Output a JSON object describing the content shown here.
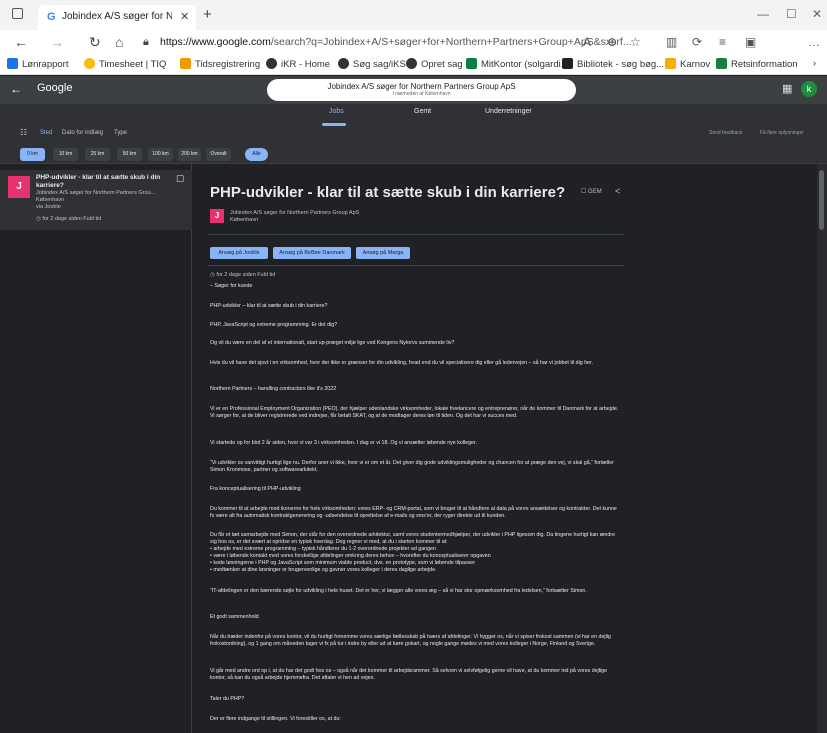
{
  "browser": {
    "tab_title": "Jobindex A/S søger for Northern",
    "url_host": "https://www.google.com",
    "url_rest": "/search?q=Jobindex+A/S+søger+for+Northern+Partners+Group+ApS&sxsrf...",
    "bookmarks": [
      "Lønrapport",
      "Timesheet | TIQ",
      "Tidsregistrering",
      "iKR - Home",
      "Søg sag/iKS",
      "Opret sag",
      "MitKontor (solgardi...",
      "Bibliotek - søg bøg...",
      "Karnov",
      "Retsinformation"
    ]
  },
  "google": {
    "logo": "Google",
    "search_query": "Jobindex A/S søger for Northern Partners Group ApS",
    "search_sub": "I nærheden af København",
    "avatar": "k",
    "tabs": [
      "Jobs",
      "Gemt",
      "Underretninger"
    ]
  },
  "filters": {
    "items": [
      "Sted",
      "Dato for indlæg",
      "Type"
    ],
    "chips": [
      "0 km",
      "10 km",
      "25 km",
      "50 km",
      "100 km",
      "200 km",
      "Overalt"
    ],
    "pill": "Alle",
    "right_links": [
      "Send feedback",
      "Få flere oplysninger"
    ]
  },
  "listing": {
    "logo": "J",
    "title": "PHP-udvikler - klar til at sætte skub i din karriere?",
    "company": "Jobindex A/S søger for Northern Partners Grou...",
    "location": "København",
    "via": "via Jooble",
    "meta": "for 2 dage siden   Fuld tid"
  },
  "detail": {
    "title": "PHP-udvikler - klar til at sætte skub i din karriere?",
    "gem": "GEM",
    "logo": "J",
    "company": "Jobindex A/S søger for Northern Partners Group ApS",
    "location": "København",
    "apply_buttons": [
      "Ansøg på Jooble",
      "Ansøg på BeBee Danmark",
      "Ansøg på Marga"
    ],
    "meta": "for 2 dage siden   Fuld tid",
    "paragraphs": [
      "– Søger for kunde",
      "PHP-udvikler – klar til at sætte skub i din karriere?",
      "PHP, JavaScript og extreme programming. Er det dig?",
      "Og vil du være en del af et internationalt, start up-præget miljø lige ved Kongens Nytorvs summende liv?",
      "Hvis du vil have det sjovt i en virksomhed, hvor der ikke er grænser for din udvikling, hvad end du vil specialisere dig eller gå ledervejen – så har vi jobbet til dig her.",
      "Northern Partners – handling contractors like it's 2022",
      "Vi er en Professional Employment Organization (PEO), der hjælper udenlandske virksomheder, lokale freelancere og entreprenører, når de kommer til Danmark for at arbejde. Vi sørger for, at de bliver registrerede ved indrejse, får betalt SKAT, og at de modtager deres løn til tiden. Og det har vi succes med.",
      "Vi startede op for blot 2 år siden, hvor vi var 3 i virksomheden. I dag er vi 18. Og vi ansætter løbende nye kolleger.",
      "“Vi udvikler os vanvittigt hurtigt lige nu. Derfor aner vi ikke, hvor vi er om et år. Det giver dig gode udviklingsmuligheder og chancen for at præge den vej, vi skal gå,” fortæller Simon Kronmose, partner og softwarearkitekt.",
      "Fra konceptualisering til PHP-udvikling",
      "Du kommer til at arbejde med ikonerne for hele virksomheden: vores ERP- og CRM-portal, som vi bruger til at håndtere al data på vores ansættelser og kontrakter. Det kunne fx være alt fra automatisk kontraktgenerering og -udsendelse til oprettelse af e-mails og sms'er, der ryger direkte ud til kunden.",
      "Du får et tæt samarbejde med Simon, der står for den overordnede arkitektur, samt vores studentermedhjælper, der udvikler i PHP ligesom dig. Da tingene hurtigt kan ændre sig hos os, er det svært at opridse en typisk hverdag. Dog regner vi med, at du i starten kommer til at:\n• arbejde med extreme programming – typisk håndterer du 1-2 overordnede projekter ad gangen\n• være i løbende kontakt med vores forskellige afdelinger omkring deres behov – hvorefter du konceptualiserer opgaven\n• kode løsningerne i PHP og JavaScript som minimum viable product, dvs. en prototype, som vi løbende tilpasser\n• medtænker at dine løsninger er brugervenlige og gavner vores kolleger i deres daglige arbejde.",
      "“IT-afdelingen er den bærende søjle for udvikling i hele huset. Det er her, vi lægger alle vores æg – så vi har stor opmærksomhed fra ledelsen,” fortsætter Simon.",
      "Et godt sammenhold",
      "Når du træder indenfor på vores kontor, vil du hurtigt fornemme vores særlige fællesskab på tværs af afdelinger. Vi hygger os, når vi spiser frokost sammen (vi har en dejlig frokostordning), og 1 gang om måneden tager vi fx på tur i indre by eller ud at køre gokart, og nogle gange mødes vi med vores kolleger i Norge, Finland og Sverige.",
      "Vi går med andre ord op i, at du har det godt hos os – også når det kommer til arbejdsrammer. Så selvom vi selvfølgelig gerne vil have, at du kommer ind på vores dejlige kontor, så kan du også arbejde hjemmefra. Det aftaler vi hen ad vejen.",
      "Taler du PHP?",
      "Der er flere indgange til stillingen. Vi forestiller os, at du:"
    ]
  }
}
